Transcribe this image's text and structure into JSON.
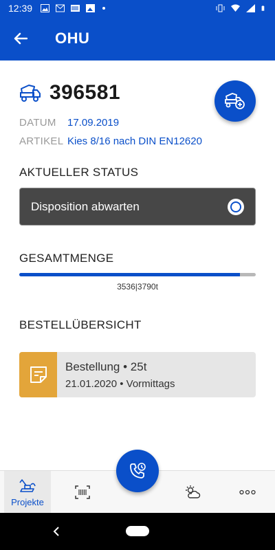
{
  "status_bar": {
    "time": "12:39"
  },
  "app_bar": {
    "title": "OHU"
  },
  "order": {
    "number": "396581",
    "datum_label": "DATUM",
    "datum_value": "17.09.2019",
    "artikel_label": "ARTIKEL",
    "artikel_value": "Kies 8/16 nach DIN EN12620"
  },
  "status_section": {
    "title": "AKTUELLER STATUS",
    "status_text": "Disposition abwarten"
  },
  "quantity_section": {
    "title": "GESAMTMENGE",
    "label": "3536|3790t",
    "progress": 0.933
  },
  "orders_section": {
    "title": "BESTELLÜBERSICHT",
    "items": [
      {
        "title": "Bestellung • 25t",
        "subtitle": "21.01.2020 • Vormittags"
      }
    ]
  },
  "bottom_nav": {
    "items": [
      {
        "label": "Projekte",
        "icon": "excavator-icon",
        "active": true
      },
      {
        "label": "",
        "icon": "barcode-scan-icon"
      },
      {
        "label": "",
        "icon": "weather-icon"
      },
      {
        "label": "",
        "icon": "more-icon"
      }
    ]
  },
  "colors": {
    "primary": "#0a4fc9",
    "status_box": "#474747",
    "card_accent": "#e3a53a"
  }
}
